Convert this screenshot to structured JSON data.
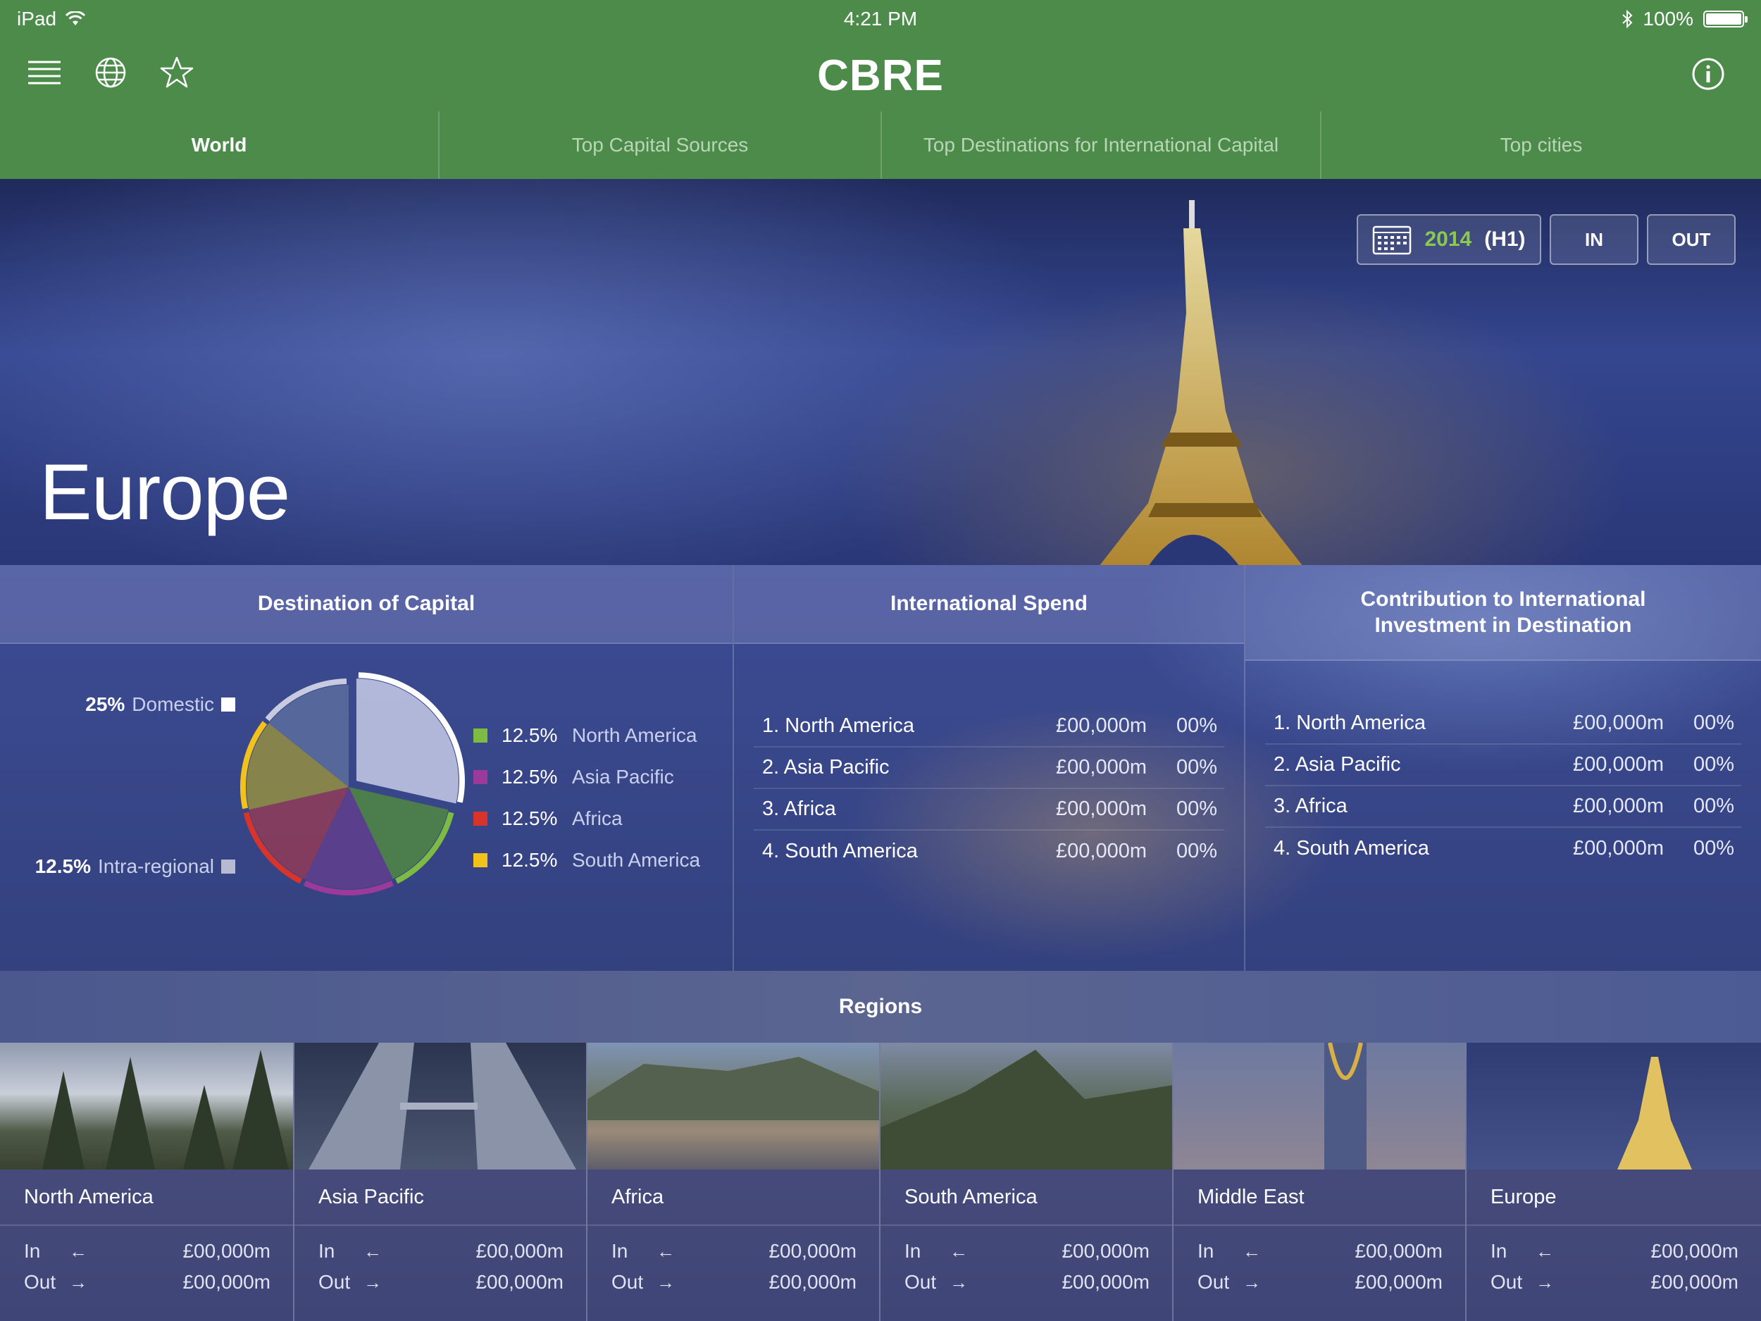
{
  "status_bar": {
    "device": "iPad",
    "time": "4:21 PM",
    "battery": "100%",
    "battery_level": 1.0
  },
  "header": {
    "logo": "CBRE",
    "icons": [
      "menu-icon",
      "globe-icon",
      "star-icon",
      "info-icon"
    ]
  },
  "tabs": [
    {
      "label": "World",
      "active": true
    },
    {
      "label": "Top Capital Sources",
      "active": false
    },
    {
      "label": "Top Destinations for International Capital",
      "active": false
    },
    {
      "label": "Top cities",
      "active": false
    }
  ],
  "hero": {
    "title": "Europe",
    "period_year": "2014",
    "period_half": "(H1)",
    "in_label": "IN",
    "out_label": "OUT"
  },
  "destination": {
    "title": "Destination of Capital",
    "domestic": {
      "pct": "25%",
      "label": "Domestic"
    },
    "intra": {
      "pct": "12.5%",
      "label": "Intra-regional"
    },
    "legend": [
      {
        "pct": "12.5%",
        "label": "North America",
        "color": "#7dbb42"
      },
      {
        "pct": "12.5%",
        "label": "Asia Pacific",
        "color": "#9b3a9a"
      },
      {
        "pct": "12.5%",
        "label": "Africa",
        "color": "#d9342b"
      },
      {
        "pct": "12.5%",
        "label": "South America",
        "color": "#f2c21b"
      }
    ]
  },
  "chart_data": {
    "type": "pie",
    "title": "Destination of Capital",
    "categories": [
      "Domestic",
      "North America",
      "Asia Pacific",
      "Africa",
      "South America",
      "Intra-regional"
    ],
    "values": [
      25,
      12.5,
      12.5,
      12.5,
      12.5,
      12.5
    ],
    "colors": [
      "#ffffff",
      "#7dbb42",
      "#9b3a9a",
      "#d9342b",
      "#f2c21b",
      "#c8cbe0"
    ]
  },
  "international_spend": {
    "title": "International Spend",
    "rows": [
      {
        "rank": "1. North America",
        "amount": "£00,000m",
        "pct": "00%"
      },
      {
        "rank": "2. Asia Pacific",
        "amount": "£00,000m",
        "pct": "00%"
      },
      {
        "rank": "3. Africa",
        "amount": "£00,000m",
        "pct": "00%"
      },
      {
        "rank": "4. South America",
        "amount": "£00,000m",
        "pct": "00%"
      }
    ]
  },
  "contribution": {
    "title_line1": "Contribution to International",
    "title_line2": "Investment in Destination",
    "rows": [
      {
        "rank": "1. North America",
        "amount": "£00,000m",
        "pct": "00%"
      },
      {
        "rank": "2. Asia Pacific",
        "amount": "£00,000m",
        "pct": "00%"
      },
      {
        "rank": "3. Africa",
        "amount": "£00,000m",
        "pct": "00%"
      },
      {
        "rank": "4. South America",
        "amount": "£00,000m",
        "pct": "00%"
      }
    ]
  },
  "regions": {
    "title": "Regions",
    "in_label": "In",
    "out_label": "Out",
    "items": [
      {
        "name": "North America",
        "in": "£00,000m",
        "out": "£00,000m"
      },
      {
        "name": "Asia Pacific",
        "in": "£00,000m",
        "out": "£00,000m"
      },
      {
        "name": "Africa",
        "in": "£00,000m",
        "out": "£00,000m"
      },
      {
        "name": "South America",
        "in": "£00,000m",
        "out": "£00,000m"
      },
      {
        "name": "Middle East",
        "in": "£00,000m",
        "out": "£00,000m"
      },
      {
        "name": "Europe",
        "in": "£00,000m",
        "out": "£00,000m"
      }
    ]
  }
}
